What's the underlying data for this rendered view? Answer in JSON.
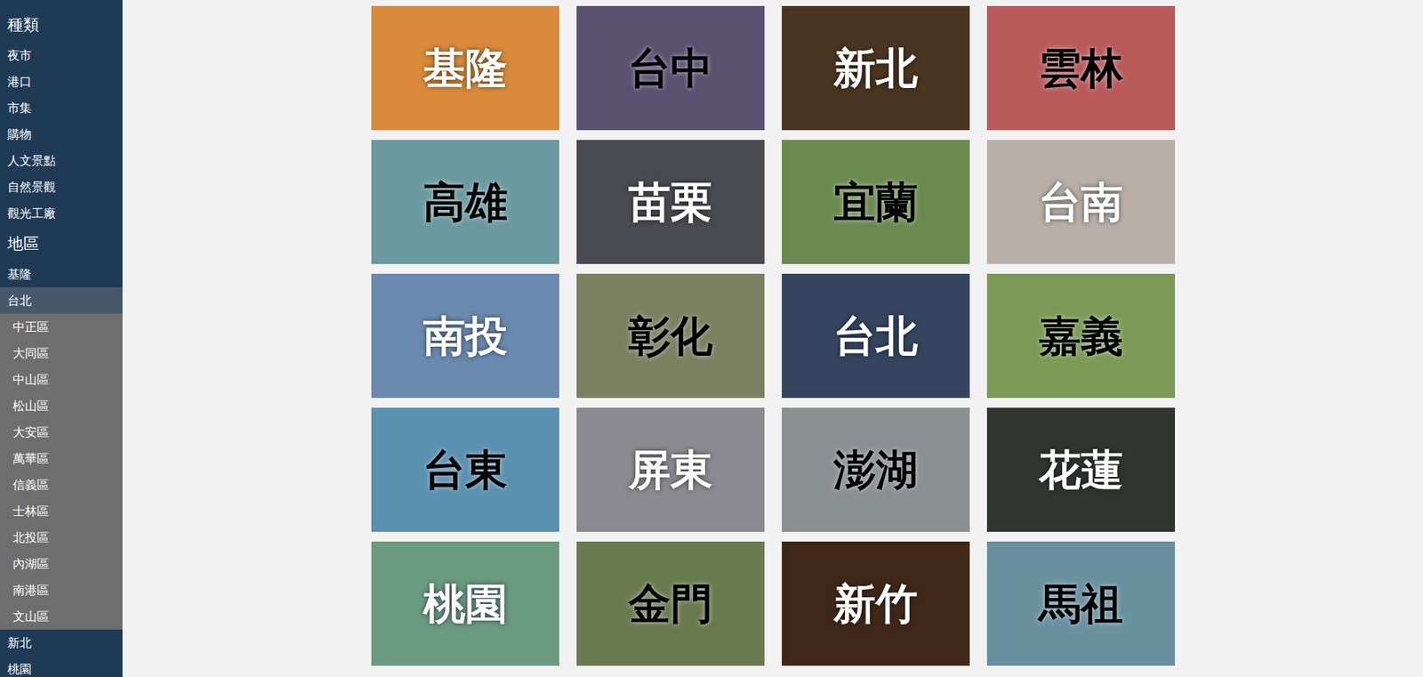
{
  "sidebar": {
    "sections": [
      {
        "heading": "種類",
        "items": [
          {
            "label": "夜市",
            "selected": false,
            "expanded": false,
            "children": []
          },
          {
            "label": "港口",
            "selected": false,
            "expanded": false,
            "children": []
          },
          {
            "label": "市集",
            "selected": false,
            "expanded": false,
            "children": []
          },
          {
            "label": "購物",
            "selected": false,
            "expanded": false,
            "children": []
          },
          {
            "label": "人文景點",
            "selected": false,
            "expanded": false,
            "children": []
          },
          {
            "label": "自然景觀",
            "selected": false,
            "expanded": false,
            "children": []
          },
          {
            "label": "觀光工廠",
            "selected": false,
            "expanded": false,
            "children": []
          }
        ]
      },
      {
        "heading": "地區",
        "items": [
          {
            "label": "基隆",
            "selected": false,
            "expanded": false,
            "children": []
          },
          {
            "label": "台北",
            "selected": true,
            "expanded": true,
            "children": [
              "中正區",
              "大同區",
              "中山區",
              "松山區",
              "大安區",
              "萬華區",
              "信義區",
              "士林區",
              "北投區",
              "內湖區",
              "南港區",
              "文山區"
            ]
          },
          {
            "label": "新北",
            "selected": false,
            "expanded": false,
            "children": []
          },
          {
            "label": "桃園",
            "selected": false,
            "expanded": false,
            "children": []
          }
        ]
      }
    ]
  },
  "cards": [
    {
      "label": "基隆",
      "color": "#d98a3a",
      "label_dark": false
    },
    {
      "label": "台中",
      "color": "#5a5070",
      "label_dark": true
    },
    {
      "label": "新北",
      "color": "#4a3520",
      "label_dark": false
    },
    {
      "label": "雲林",
      "color": "#b85a5a",
      "label_dark": true
    },
    {
      "label": "高雄",
      "color": "#6a9aa0",
      "label_dark": true
    },
    {
      "label": "苗栗",
      "color": "#4a4a52",
      "label_dark": false
    },
    {
      "label": "宜蘭",
      "color": "#6a8a50",
      "label_dark": true
    },
    {
      "label": "台南",
      "color": "#b8b0a8",
      "label_dark": false
    },
    {
      "label": "南投",
      "color": "#6a8ab0",
      "label_dark": false
    },
    {
      "label": "彰化",
      "color": "#7a8060",
      "label_dark": true
    },
    {
      "label": "台北",
      "color": "#354560",
      "label_dark": false
    },
    {
      "label": "嘉義",
      "color": "#7a9a55",
      "label_dark": true
    },
    {
      "label": "台東",
      "color": "#5a90b0",
      "label_dark": true
    },
    {
      "label": "屏東",
      "color": "#8a8a90",
      "label_dark": false
    },
    {
      "label": "澎湖",
      "color": "#8a9090",
      "label_dark": true
    },
    {
      "label": "花蓮",
      "color": "#303530",
      "label_dark": false
    },
    {
      "label": "桃園",
      "color": "#6a9a80",
      "label_dark": false
    },
    {
      "label": "金門",
      "color": "#6a7a50",
      "label_dark": true
    },
    {
      "label": "新竹",
      "color": "#402818",
      "label_dark": false
    },
    {
      "label": "馬祖",
      "color": "#6a90a0",
      "label_dark": true
    }
  ]
}
